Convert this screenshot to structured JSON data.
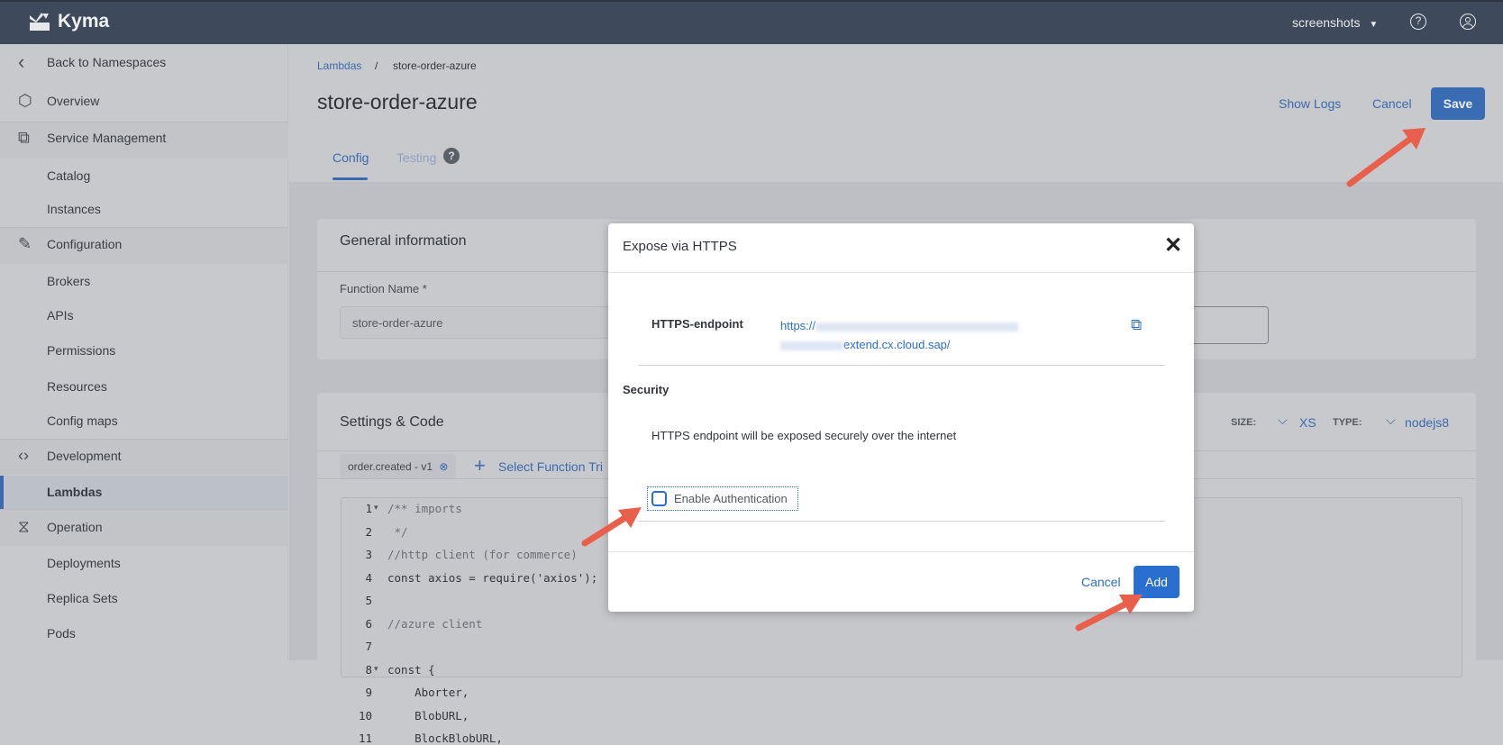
{
  "header": {
    "brand": "Kyma",
    "namespace": "screenshots",
    "help_icon": "help-circle-icon",
    "user_icon": "user-circle-icon"
  },
  "sidebar": {
    "back": "Back to Namespaces",
    "overview": "Overview",
    "sections": [
      {
        "label": "Service Management",
        "items": [
          "Catalog",
          "Instances"
        ]
      },
      {
        "label": "Configuration",
        "items": [
          "Brokers",
          "APIs",
          "Permissions",
          "Resources",
          "Config maps"
        ]
      },
      {
        "label": "Development",
        "items": [
          "Lambdas"
        ]
      },
      {
        "label": "Operation",
        "items": [
          "Deployments",
          "Replica Sets",
          "Pods"
        ]
      }
    ],
    "selected": "Lambdas"
  },
  "breadcrumb": {
    "parent": "Lambdas",
    "separator": "/",
    "current": "store-order-azure"
  },
  "page": {
    "title": "store-order-azure",
    "show_logs": "Show Logs",
    "cancel": "Cancel",
    "save": "Save",
    "tabs": [
      {
        "label": "Config",
        "active": true
      },
      {
        "label": "Testing",
        "badge": "?"
      }
    ]
  },
  "general": {
    "title": "General information",
    "function_name_label": "Function Name *",
    "function_name_value": "store-order-azure"
  },
  "settings": {
    "title": "Settings & Code",
    "size_label": "SIZE:",
    "size_value": "XS",
    "type_label": "TYPE:",
    "type_value": "nodejs8",
    "trigger_chip": "order.created - v1",
    "select_trigger": "Select Function Tri",
    "code": [
      {
        "n": "1",
        "fold": true,
        "t": "/** imports",
        "c": "comment"
      },
      {
        "n": "2",
        "t": " */",
        "c": "comment"
      },
      {
        "n": "3",
        "t": "//http client (for commerce)",
        "c": "comment"
      },
      {
        "n": "4",
        "t": "const axios = require('axios');",
        "c": "code"
      },
      {
        "n": "5",
        "t": "",
        "c": "code"
      },
      {
        "n": "6",
        "t": "//azure client",
        "c": "comment"
      },
      {
        "n": "7",
        "t": "",
        "c": "code"
      },
      {
        "n": "8",
        "fold": true,
        "t": "const {",
        "c": "code"
      },
      {
        "n": "9",
        "t": "    Aborter,",
        "c": "code"
      },
      {
        "n": "10",
        "t": "    BlobURL,",
        "c": "code"
      },
      {
        "n": "11",
        "t": "    BlockBlobURL,",
        "c": "code"
      }
    ]
  },
  "modal": {
    "title": "Expose via HTTPS",
    "endpoint_label": "HTTPS-endpoint",
    "endpoint_line1": "https://",
    "endpoint_line2": "extend.cx.cloud.sap/",
    "security_title": "Security",
    "security_text": "HTTPS endpoint will be exposed securely over the internet",
    "auth_label": "Enable Authentication",
    "auth_checked": false,
    "cancel": "Cancel",
    "add": "Add"
  },
  "colors": {
    "accent": "#2a6fd0",
    "arrow": "#e8604c",
    "header": "#3e4a5b"
  }
}
